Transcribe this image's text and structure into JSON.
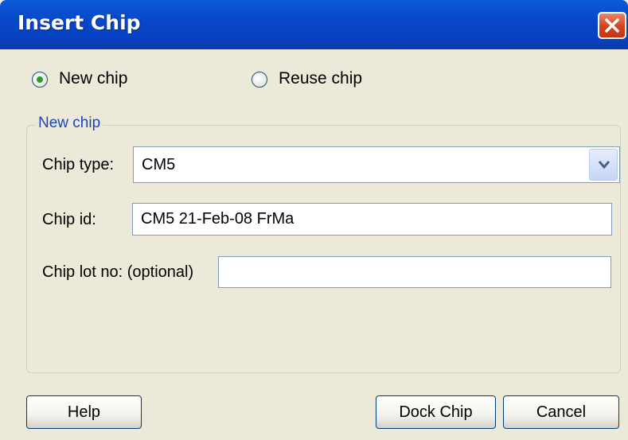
{
  "window": {
    "title": "Insert Chip"
  },
  "mode": {
    "options": [
      {
        "label": "New chip",
        "selected": true
      },
      {
        "label": "Reuse chip",
        "selected": false
      }
    ]
  },
  "group": {
    "legend": "New chip",
    "chip_type": {
      "label": "Chip type:",
      "value": "CM5"
    },
    "chip_id": {
      "label": "Chip id:",
      "value": "CM5 21-Feb-08 FrMa"
    },
    "chip_lot": {
      "label": "Chip lot no: (optional)",
      "value": ""
    }
  },
  "buttons": {
    "help": "Help",
    "dock": "Dock Chip",
    "cancel": "Cancel"
  },
  "colors": {
    "title_bar": "#0848c9",
    "legend_text": "#1a46b8",
    "radio_dot": "#2d9c2d",
    "close_button": "#d2421f"
  }
}
